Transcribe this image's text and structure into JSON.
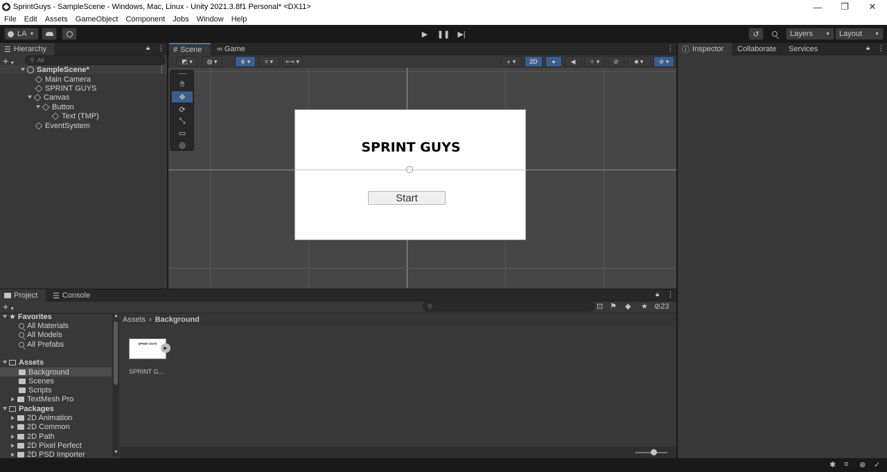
{
  "window": {
    "title": "SprintGuys - SampleScene - Windows, Mac, Linux - Unity 2021.3.8f1 Personal* <DX11>",
    "minimize_glyph": "—",
    "maximize_glyph": "❐",
    "close_glyph": "✕"
  },
  "menu": [
    "File",
    "Edit",
    "Assets",
    "GameObject",
    "Component",
    "Jobs",
    "Window",
    "Help"
  ],
  "toolbar": {
    "account_label": "LA",
    "layers_label": "Layers",
    "layout_label": "Layout"
  },
  "hierarchy": {
    "tab_label": "Hierarchy",
    "search_placeholder": "All",
    "scene_name": "SampleScene*",
    "items": [
      "Main Camera",
      "SPRINT GUYS",
      "Canvas",
      "Button",
      "Text (TMP)",
      "EventSystem"
    ]
  },
  "scene_view": {
    "tabs": [
      "Scene",
      "Game"
    ],
    "toggle_2d_label": "2D",
    "canvas_title": "SPRINT GUYS",
    "button_label": "Start"
  },
  "inspector": {
    "tabs": [
      "Inspector",
      "Collaborate",
      "Services"
    ]
  },
  "project": {
    "tabs": [
      "Project",
      "Console"
    ],
    "hidden_count": "23",
    "breadcrumb": [
      "Assets",
      "Background"
    ],
    "favorites_label": "Favorites",
    "favorites": [
      "All Materials",
      "All Models",
      "All Prefabs"
    ],
    "assets_label": "Assets",
    "assets_folders": [
      "Background",
      "Scenes",
      "Scripts",
      "TextMesh Pro"
    ],
    "packages_label": "Packages",
    "packages": [
      "2D Animation",
      "2D Common",
      "2D Path",
      "2D Pixel Perfect",
      "2D PSD Importer"
    ],
    "asset_items": [
      {
        "label": "SPRINT G...",
        "thumb_text": "SPRINT GUYS"
      }
    ]
  },
  "colors": {
    "accent": "#3a79bb",
    "panel": "#383838",
    "selected_row": "#2c5d87"
  }
}
